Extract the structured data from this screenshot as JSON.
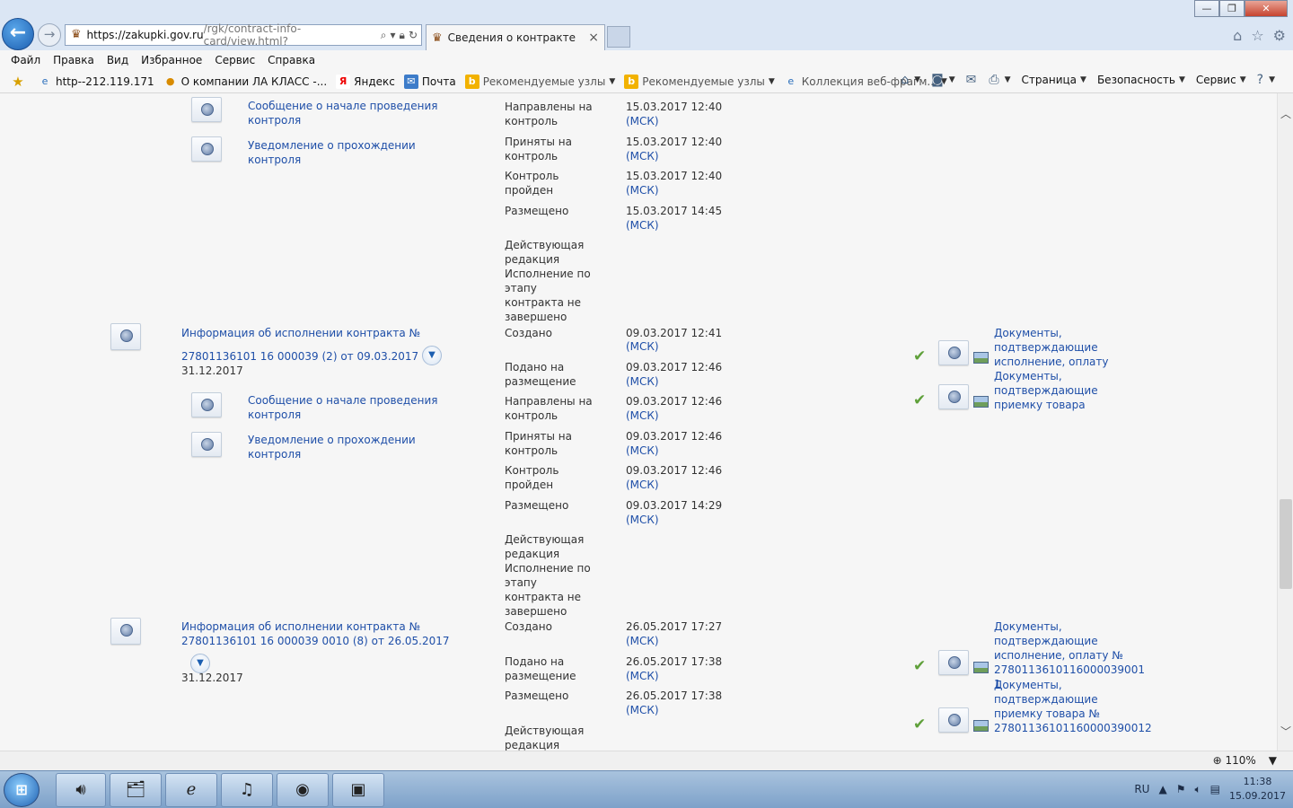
{
  "browser": {
    "url_host": "https://zakupki.gov.ru",
    "url_path": "/rgk/contract-info-card/view.html?",
    "tab_title": "Сведения о контракте",
    "menu": [
      "Файл",
      "Правка",
      "Вид",
      "Избранное",
      "Сервис",
      "Справка"
    ],
    "favorites": [
      {
        "label": "http--212.119.171",
        "icon": "ie-page-icon"
      },
      {
        "label": "О компании ЛА КЛАСС -...",
        "icon": "user-icon"
      },
      {
        "label": "Яндекс",
        "icon": "yandex-icon"
      },
      {
        "label": "Почта",
        "icon": "mail-icon"
      },
      {
        "label": "Рекомендуемые узлы",
        "icon": "bing-icon"
      },
      {
        "label": "Рекомендуемые узлы",
        "icon": "bing-icon"
      },
      {
        "label": "Коллекция веб-фрагм...",
        "icon": "ie-page-icon"
      }
    ],
    "commands": [
      "Страница",
      "Безопасность",
      "Сервис"
    ],
    "zoom": "110%"
  },
  "content": {
    "block0": {
      "sub1": "Сообщение о начале проведения контроля",
      "sub2": "Уведомление о прохождении контроля",
      "statuses": [
        {
          "label": "Направлены на контроль",
          "date": "15.03.2017 12:40",
          "tz": "(МСК)"
        },
        {
          "label": "Приняты на контроль",
          "date": "15.03.2017 12:40",
          "tz": "(МСК)"
        },
        {
          "label": "Контроль пройден",
          "date": "15.03.2017 12:40",
          "tz": "(МСК)"
        },
        {
          "label": "Размещено",
          "date": "15.03.2017 14:45",
          "tz": "(МСК)"
        }
      ],
      "state": "Действующая редакция Исполнение по этапу контракта не завершено"
    },
    "block1": {
      "title_line1": "Информация об исполнении контракта №",
      "title_line2": "27801136101 16 000039 (2) от 09.03.2017",
      "period": "31.12.2017",
      "sub1": "Сообщение о начале проведения контроля",
      "sub2": "Уведомление о прохождении контроля",
      "statuses": [
        {
          "label": "Создано",
          "date": "09.03.2017 12:41",
          "tz": "(МСК)"
        },
        {
          "label": "Подано на размещение",
          "date": "09.03.2017 12:46",
          "tz": "(МСК)"
        },
        {
          "label": "Направлены на контроль",
          "date": "09.03.2017 12:46",
          "tz": "(МСК)"
        },
        {
          "label": "Приняты на контроль",
          "date": "09.03.2017 12:46",
          "tz": "(МСК)"
        },
        {
          "label": "Контроль пройден",
          "date": "09.03.2017 12:46",
          "tz": "(МСК)"
        },
        {
          "label": "Размещено",
          "date": "09.03.2017 14:29",
          "tz": "(МСК)"
        }
      ],
      "state": "Действующая редакция Исполнение по этапу контракта не завершено",
      "docs": [
        "Документы, подтверждающие исполнение, оплату",
        "Документы, подтверждающие приемку товара"
      ]
    },
    "block2": {
      "title_line1": "Информация об исполнении контракта №",
      "title_line2": "27801136101 16 000039 0010 (8) от 26.05.2017",
      "period": "31.12.2017",
      "statuses": [
        {
          "label": "Создано",
          "date": "26.05.2017 17:27",
          "tz": "(МСК)"
        },
        {
          "label": "Подано на размещение",
          "date": "26.05.2017 17:38",
          "tz": "(МСК)"
        },
        {
          "label": "Размещено",
          "date": "26.05.2017 17:38",
          "tz": "(МСК)"
        }
      ],
      "state": "Действующая редакция",
      "docs": [
        "Документы, подтверждающие исполнение, оплату № 2780113610116000039001​1",
        "Документы, подтверждающие приемку товара № 27801136101160000390012"
      ]
    }
  },
  "taskbar": {
    "lang": "RU",
    "time": "11:38",
    "date": "15.09.2017"
  }
}
